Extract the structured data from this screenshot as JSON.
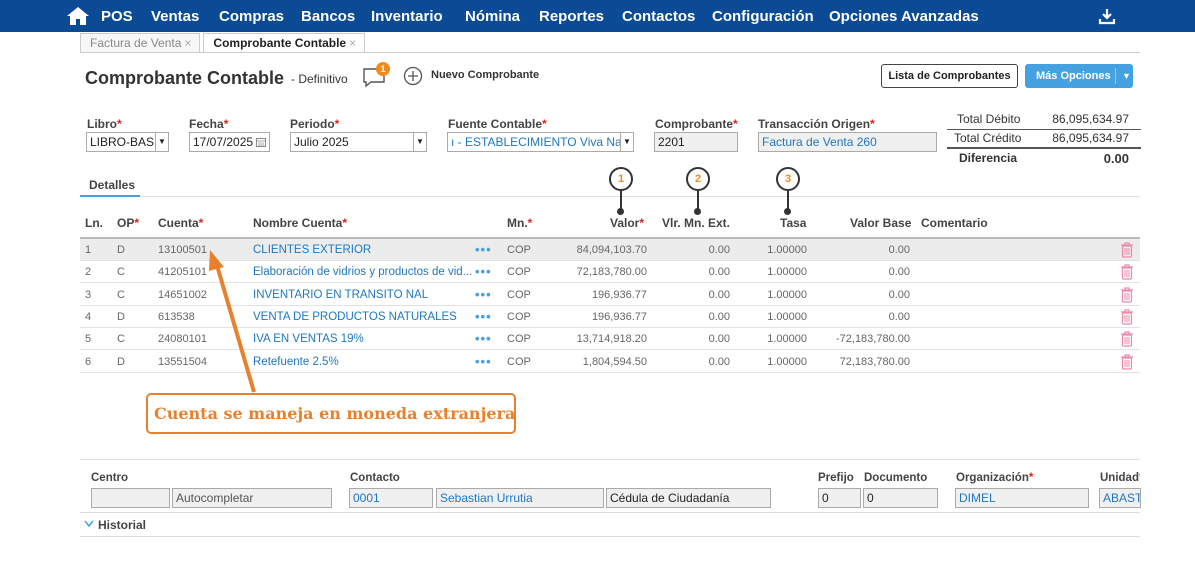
{
  "nav": {
    "items": [
      "POS",
      "Ventas",
      "Compras",
      "Bancos",
      "Inventario",
      "Nómina",
      "Reportes",
      "Contactos",
      "Configuración",
      "Opciones Avanzadas"
    ]
  },
  "tabs": [
    {
      "label": "Factura de Venta",
      "close": "×"
    },
    {
      "label": "Comprobante Contable",
      "close": "×"
    }
  ],
  "header": {
    "title": "Comprobante Contable",
    "subtitle": "- Definitivo",
    "notification_count": "1",
    "new_label": "Nuevo Comprobante",
    "list_button": "Lista de Comprobantes",
    "more_button": "Más Opciones"
  },
  "form": {
    "libro_label": "Libro",
    "libro_value": "LIBRO-BASE",
    "fecha_label": "Fecha",
    "fecha_value": "17/07/2025",
    "periodo_label": "Periodo",
    "periodo_value": "Julio 2025",
    "fuente_label": "Fuente Contable",
    "fuente_value": "ı - ESTABLECIMIENTO Viva Natural",
    "comprobante_label": "Comprobante",
    "comprobante_value": "2201",
    "transaccion_label": "Transacción Origen",
    "transaccion_value": "Factura de Venta 260",
    "required_mark": "*"
  },
  "totals": {
    "debito_label": "Total Débito",
    "debito_value": "86,095,634.97",
    "credito_label": "Total Crédito",
    "credito_value": "86,095,634.97",
    "diferencia_label": "Diferencia",
    "diferencia_value": "0.00"
  },
  "details_tab": "Detalles",
  "markers": [
    "1",
    "2",
    "3"
  ],
  "table": {
    "headers": {
      "ln": "Ln.",
      "op": "OP",
      "cuenta": "Cuenta",
      "nombre": "Nombre Cuenta",
      "mn": "Mn.",
      "valor": "Valor",
      "vlr_ext": "Vlr. Mn. Ext.",
      "tasa": "Tasa",
      "valor_base": "Valor Base",
      "comentario": "Comentario"
    },
    "rows": [
      {
        "ln": "1",
        "op": "D",
        "cuenta": "13100501",
        "nombre": "CLIENTES EXTERIOR",
        "mn": "COP",
        "valor": "84,094,103.70",
        "ext": "0.00",
        "tasa": "1.00000",
        "base": "0.00"
      },
      {
        "ln": "2",
        "op": "C",
        "cuenta": "41205101",
        "nombre": "Elaboración de vidrios y productos de vid...",
        "mn": "COP",
        "valor": "72,183,780.00",
        "ext": "0.00",
        "tasa": "1.00000",
        "base": "0.00"
      },
      {
        "ln": "3",
        "op": "C",
        "cuenta": "14651002",
        "nombre": "INVENTARIO EN TRANSITO NAL",
        "mn": "COP",
        "valor": "196,936.77",
        "ext": "0.00",
        "tasa": "1.00000",
        "base": "0.00"
      },
      {
        "ln": "4",
        "op": "D",
        "cuenta": "613538",
        "nombre": "VENTA DE PRODUCTOS NATURALES",
        "mn": "COP",
        "valor": "196,936.77",
        "ext": "0.00",
        "tasa": "1.00000",
        "base": "0.00"
      },
      {
        "ln": "5",
        "op": "C",
        "cuenta": "24080101",
        "nombre": "IVA EN VENTAS 19%",
        "mn": "COP",
        "valor": "13,714,918.20",
        "ext": "0.00",
        "tasa": "1.00000",
        "base": "-72,183,780.00"
      },
      {
        "ln": "6",
        "op": "D",
        "cuenta": "13551504",
        "nombre": "Retefuente 2.5%",
        "mn": "COP",
        "valor": "1,804,594.50",
        "ext": "0.00",
        "tasa": "1.00000",
        "base": "72,183,780.00"
      }
    ],
    "row_dots": "•••"
  },
  "callout": "Cuenta se maneja en moneda extranjera",
  "bottom": {
    "centro_label": "Centro",
    "centro_code": "",
    "centro_placeholder": "Autocompletar",
    "contacto_label": "Contacto",
    "contacto_code": "0001",
    "contacto_name": "Sebastian Urrutia",
    "contacto_doc": "Cédula de Ciudadanía",
    "prefijo_label": "Prefijo",
    "prefijo_value": "0",
    "documento_label": "Documento",
    "documento_value": "0",
    "organizacion_label": "Organización",
    "organizacion_value": "DIMEL",
    "unidad_label": "Unidad",
    "unidad_value": "ABASTE"
  },
  "historial": "Historial",
  "colors": {
    "nav": "#0b4a95",
    "accent": "#45a1e0",
    "callout": "#e8812e",
    "required": "#d9241c",
    "link": "#1f77c0"
  }
}
